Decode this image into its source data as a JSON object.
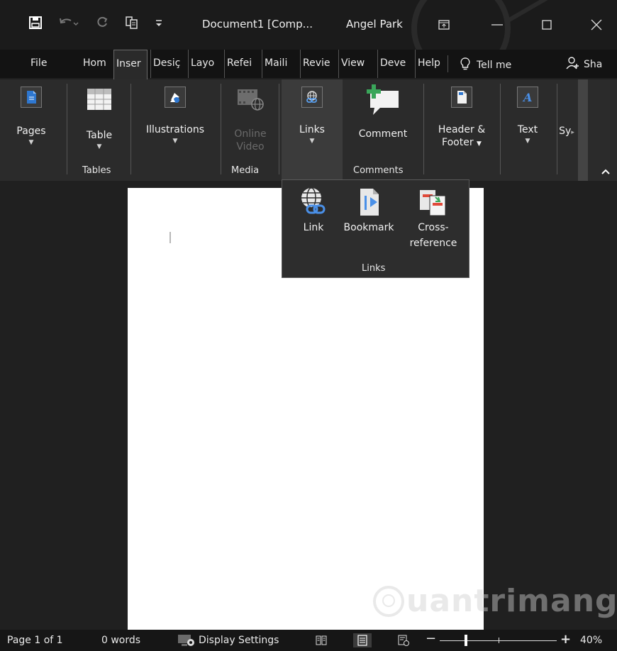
{
  "window": {
    "doc_title": "Document1 [Comp...",
    "user": "Angel Park"
  },
  "tabs": [
    {
      "label": "File"
    },
    {
      "label": "Hom"
    },
    {
      "label": "Inser"
    },
    {
      "label": "Desiç"
    },
    {
      "label": "Layo"
    },
    {
      "label": "Refei"
    },
    {
      "label": "Maili"
    },
    {
      "label": "Revie"
    },
    {
      "label": "View"
    },
    {
      "label": "Deve"
    },
    {
      "label": "Help"
    }
  ],
  "tell_me": "Tell me",
  "share": "Sha",
  "ribbon": {
    "pages": {
      "label": "Pages",
      "icon": "pages-icon"
    },
    "table": {
      "label": "Table",
      "icon": "table-icon"
    },
    "illustrations": {
      "label": "Illustrations",
      "icon": "illustrations-icon"
    },
    "online_video": {
      "label1": "Online",
      "label2": "Video",
      "icon": "online-video-icon"
    },
    "links": {
      "label": "Links",
      "icon": "links-icon"
    },
    "comment": {
      "label": "Comment",
      "icon": "comment-icon"
    },
    "header_footer": {
      "label1": "Header &",
      "label2": "Footer",
      "icon": "header-footer-icon"
    },
    "text": {
      "label": "Text",
      "icon": "text-icon"
    },
    "symbols": {
      "label": "Sy"
    },
    "groups": {
      "tables": "Tables",
      "media": "Media",
      "comments": "Comments"
    }
  },
  "links_panel": {
    "link": "Link",
    "bookmark": "Bookmark",
    "cross1": "Cross-",
    "cross2": "reference",
    "group": "Links"
  },
  "status": {
    "page": "Page 1 of 1",
    "words": "0 words",
    "display_settings": "Display Settings",
    "zoom": "40%"
  },
  "watermark": "uantrimang",
  "colors": {
    "accent_blue": "#2e77d0",
    "ribbon_bg": "#2b2b2b",
    "title_bg": "#1b1b1b"
  }
}
